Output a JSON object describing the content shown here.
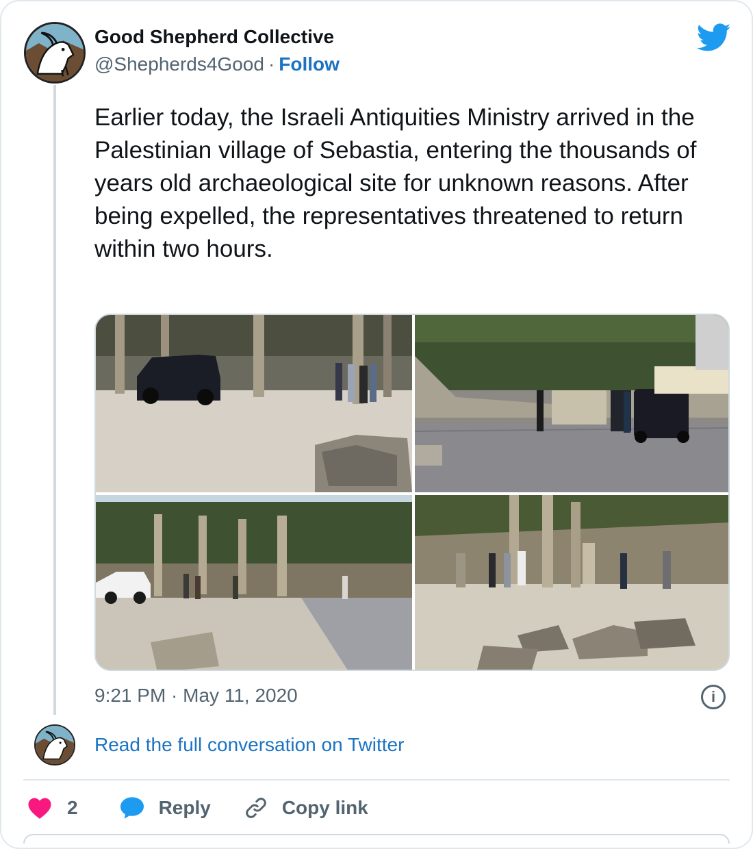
{
  "author": {
    "name": "Good Shepherd Collective",
    "handle": "@Shepherds4Good",
    "separator": "·",
    "follow_label": "Follow",
    "avatar_icon": "goat-logo-icon"
  },
  "tweet": {
    "text": "Earlier today, the Israeli Antiquities Ministry arrived in the Palestinian village of Sebastia, entering the thousands of years old archaeological site for unknown reasons. After being expelled, the representatives threatened to return within two hours.",
    "timestamp": "9:21 PM · May 11, 2020"
  },
  "conversation": {
    "link_label": "Read the full conversation on Twitter"
  },
  "actions": {
    "like_count": "2",
    "reply_label": "Reply",
    "copy_link_label": "Copy link"
  },
  "icons": {
    "brand": "twitter-bird-icon",
    "info": "info-icon",
    "like": "heart-icon",
    "reply": "reply-bubble-icon",
    "copy": "link-icon"
  },
  "colors": {
    "link": "#1b73c2",
    "twitter_blue": "#1d9bf0",
    "heart": "#f91880",
    "muted": "#536471"
  }
}
